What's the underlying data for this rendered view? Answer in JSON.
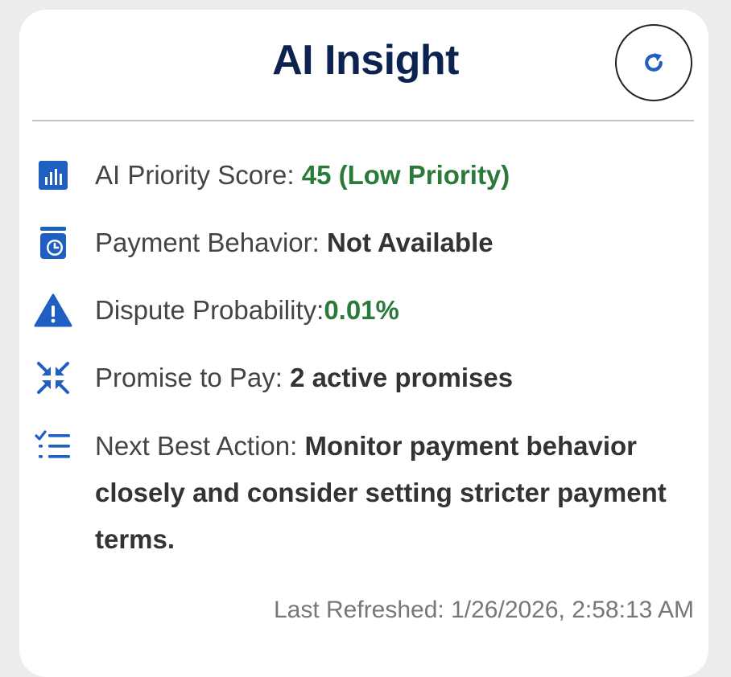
{
  "header": {
    "title": "AI Insight",
    "refresh_icon": "refresh-icon"
  },
  "insights": {
    "priority": {
      "icon": "bar-chart-icon",
      "label": "AI Priority Score: ",
      "value": "45 (Low Priority)"
    },
    "payment_behavior": {
      "icon": "calendar-clock-icon",
      "label": "Payment Behavior: ",
      "value": "Not Available"
    },
    "dispute": {
      "icon": "warning-icon",
      "label": "Dispute Probability:",
      "value": "0.01%"
    },
    "promise": {
      "icon": "compress-arrows-icon",
      "label": "Promise to Pay: ",
      "value": "2 active promises"
    },
    "next_action": {
      "icon": "checklist-icon",
      "label": "Next Best Action: ",
      "value": "Monitor payment behavior closely and consider setting stricter payment terms."
    }
  },
  "footer": {
    "last_refreshed": "Last Refreshed: 1/26/2026, 2:58:13 AM"
  },
  "colors": {
    "title": "#0c2250",
    "icon_blue": "#1f5fc2",
    "value_green": "#2a7a3a"
  }
}
